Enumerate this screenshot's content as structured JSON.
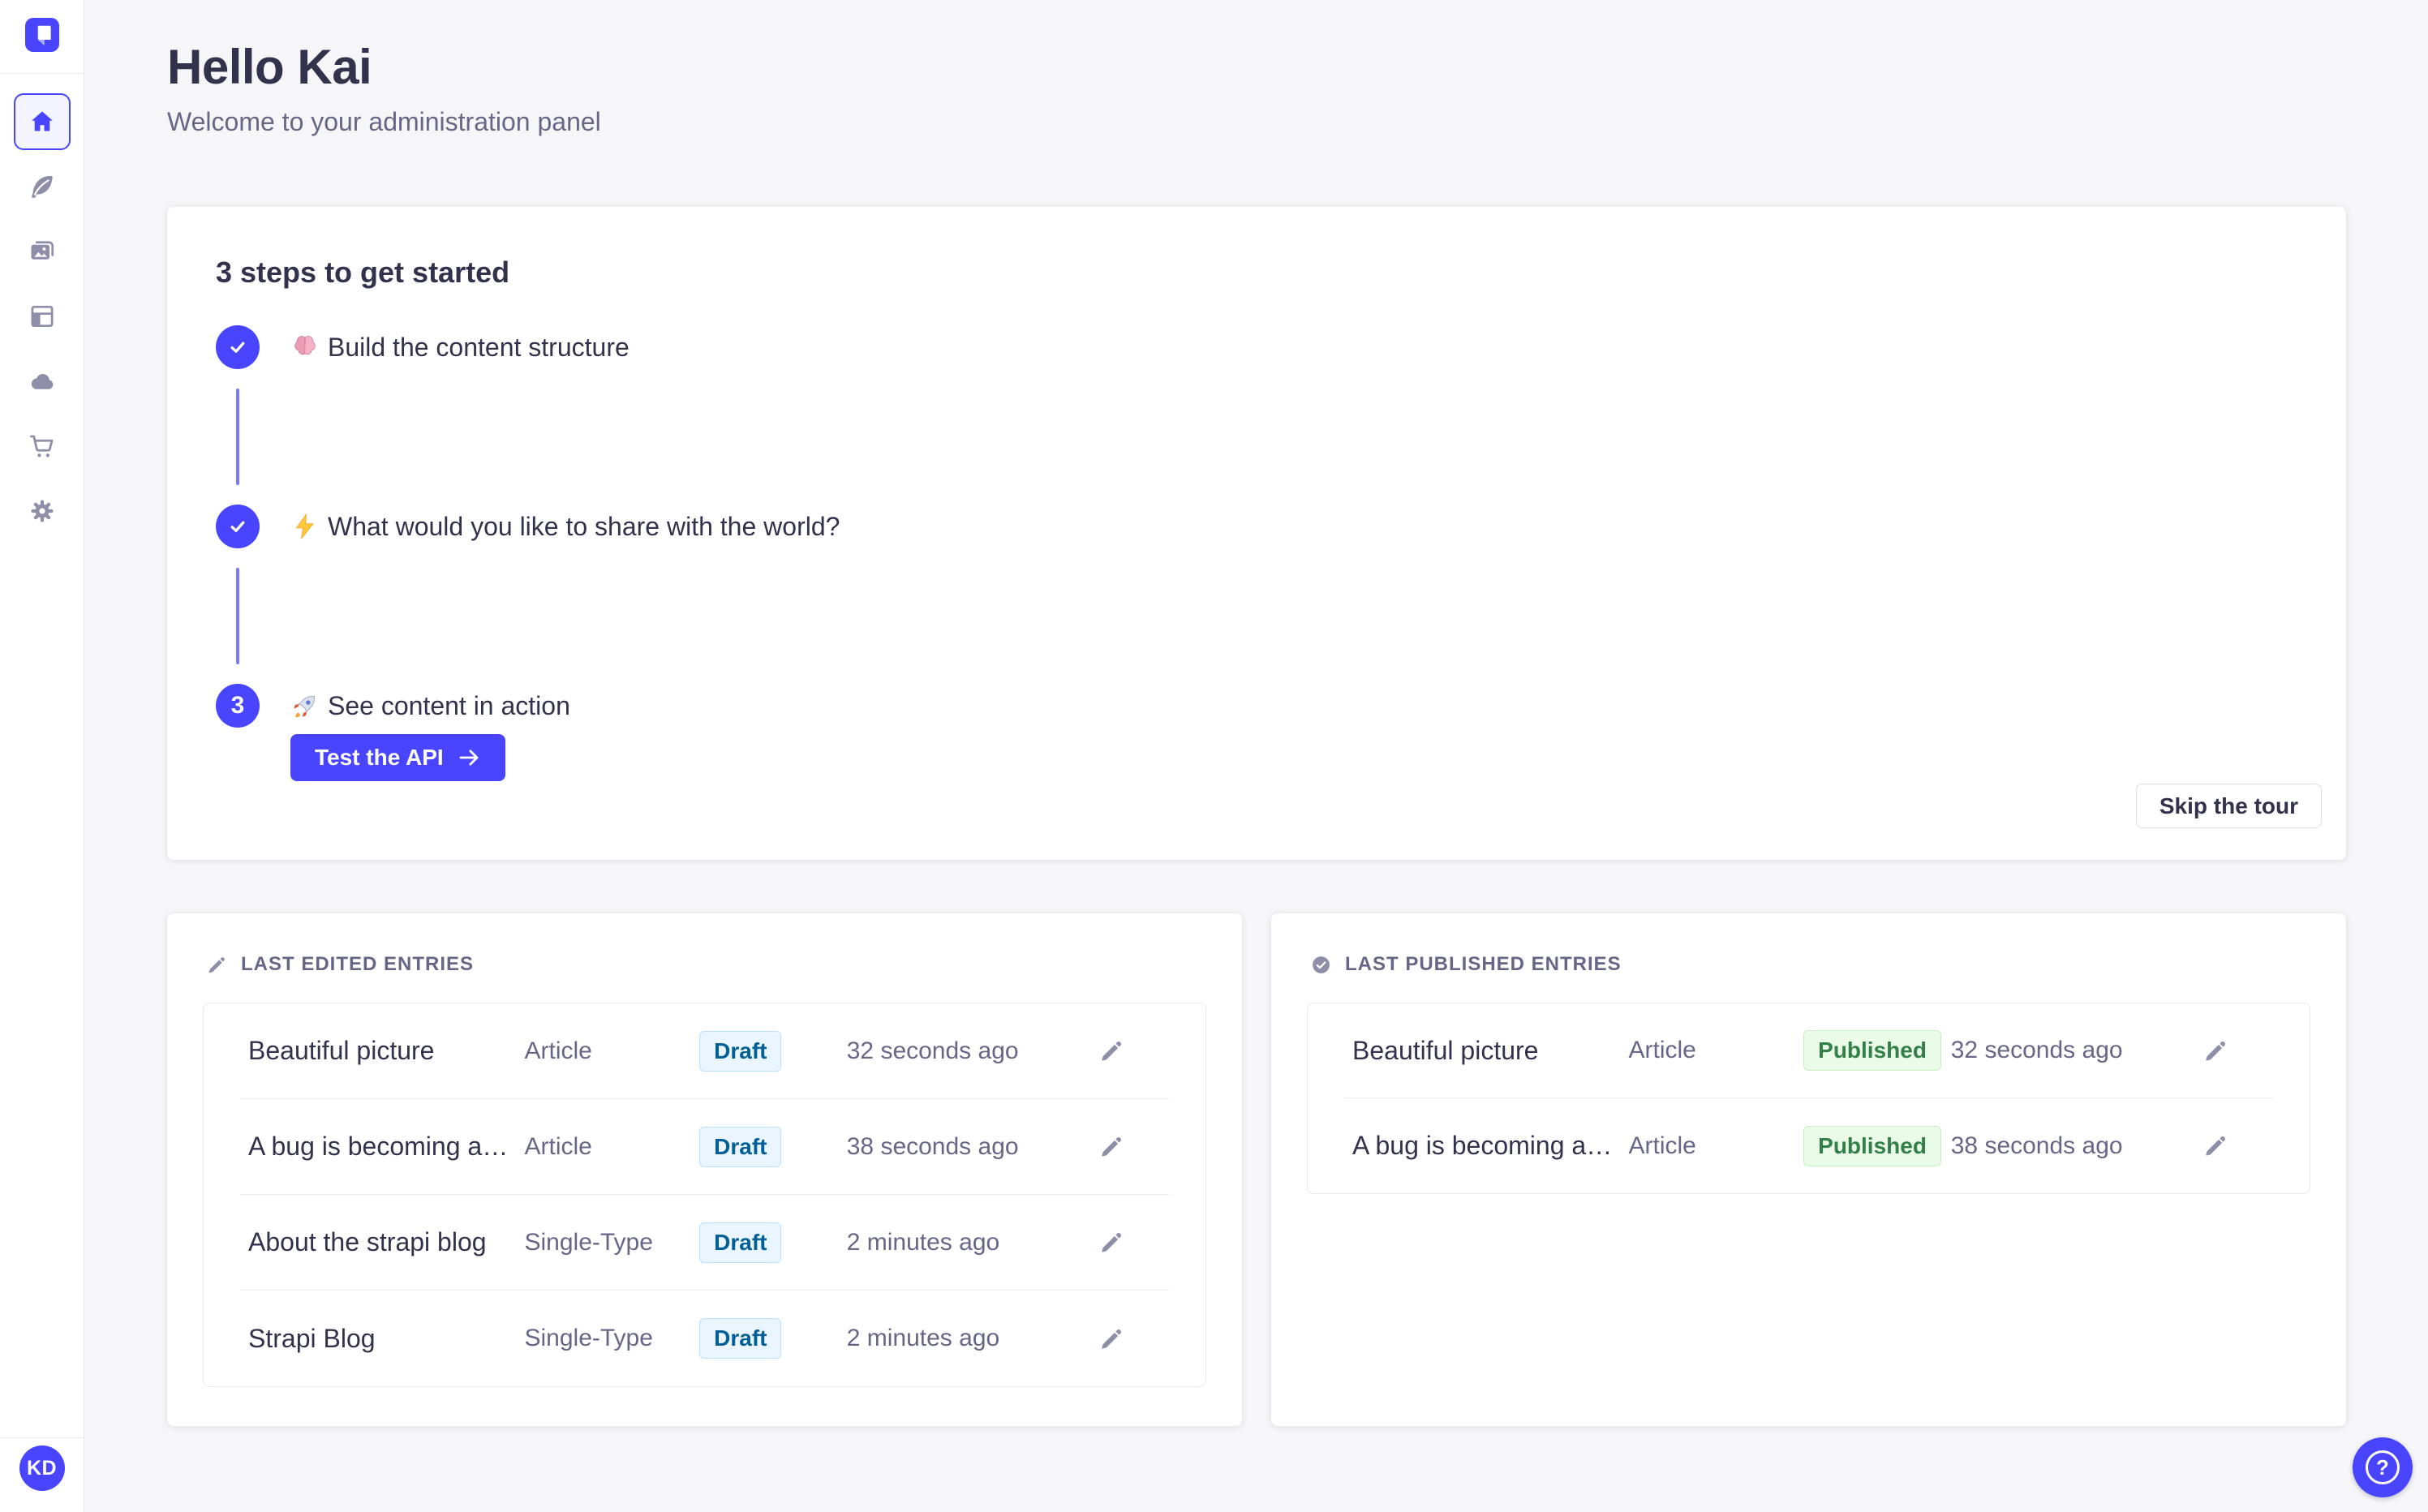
{
  "colors": {
    "accent": "#4945FF",
    "accent-line": "#7B79FF",
    "page-bg": "#F6F6F9",
    "border": "#EAEAEF",
    "border-strong": "#DCDCE4",
    "text-dark": "#32324D",
    "text-gray": "#666687",
    "icon-gray": "#8E8EA9",
    "draft-bg": "#EAF5FF",
    "draft-border": "#B8E1FF",
    "draft-text": "#006096",
    "published-bg": "#EAFBE7",
    "published-border": "#C6F0C2",
    "published-text": "#328048"
  },
  "sidebar": {
    "logo_icon": "strapi-logo",
    "nav": [
      {
        "icon": "home-icon",
        "active": true
      },
      {
        "icon": "feather-icon",
        "active": false
      },
      {
        "icon": "media-library-icon",
        "active": false
      },
      {
        "icon": "layout-icon",
        "active": false
      },
      {
        "icon": "cloud-icon",
        "active": false
      },
      {
        "icon": "cart-icon",
        "active": false
      },
      {
        "icon": "gear-icon",
        "active": false
      }
    ],
    "avatar_initials": "KD"
  },
  "header": {
    "title": "Hello Kai",
    "subtitle": "Welcome to your administration panel"
  },
  "tour": {
    "title": "3 steps to get started",
    "steps": [
      {
        "state": "done",
        "emoji": "brain-emoji",
        "label": "Build the content structure"
      },
      {
        "state": "done",
        "emoji": "zap-emoji",
        "label": "What would you like to share with the world?"
      },
      {
        "state": "current",
        "number": "3",
        "emoji": "rocket-emoji",
        "label": "See content in action"
      }
    ],
    "cta_label": "Test the API",
    "skip_label": "Skip the tour"
  },
  "edited": {
    "title": "LAST EDITED ENTRIES",
    "icon": "pencil-icon",
    "rows": [
      {
        "title": "Beautiful picture",
        "type": "Article",
        "badge": "Draft",
        "time": "32 seconds ago"
      },
      {
        "title": "A bug is becoming a…",
        "type": "Article",
        "badge": "Draft",
        "time": "38 seconds ago"
      },
      {
        "title": "About the strapi blog",
        "type": "Single-Type",
        "badge": "Draft",
        "time": "2 minutes ago"
      },
      {
        "title": "Strapi Blog",
        "type": "Single-Type",
        "badge": "Draft",
        "time": "2 minutes ago"
      }
    ]
  },
  "published": {
    "title": "LAST PUBLISHED ENTRIES",
    "icon": "check-circle-icon",
    "rows": [
      {
        "title": "Beautiful picture",
        "type": "Article",
        "badge": "Published",
        "time": "32 seconds ago"
      },
      {
        "title": "A bug is becoming a…",
        "type": "Article",
        "badge": "Published",
        "time": "38 seconds ago"
      }
    ]
  },
  "help": {
    "label": "?"
  }
}
